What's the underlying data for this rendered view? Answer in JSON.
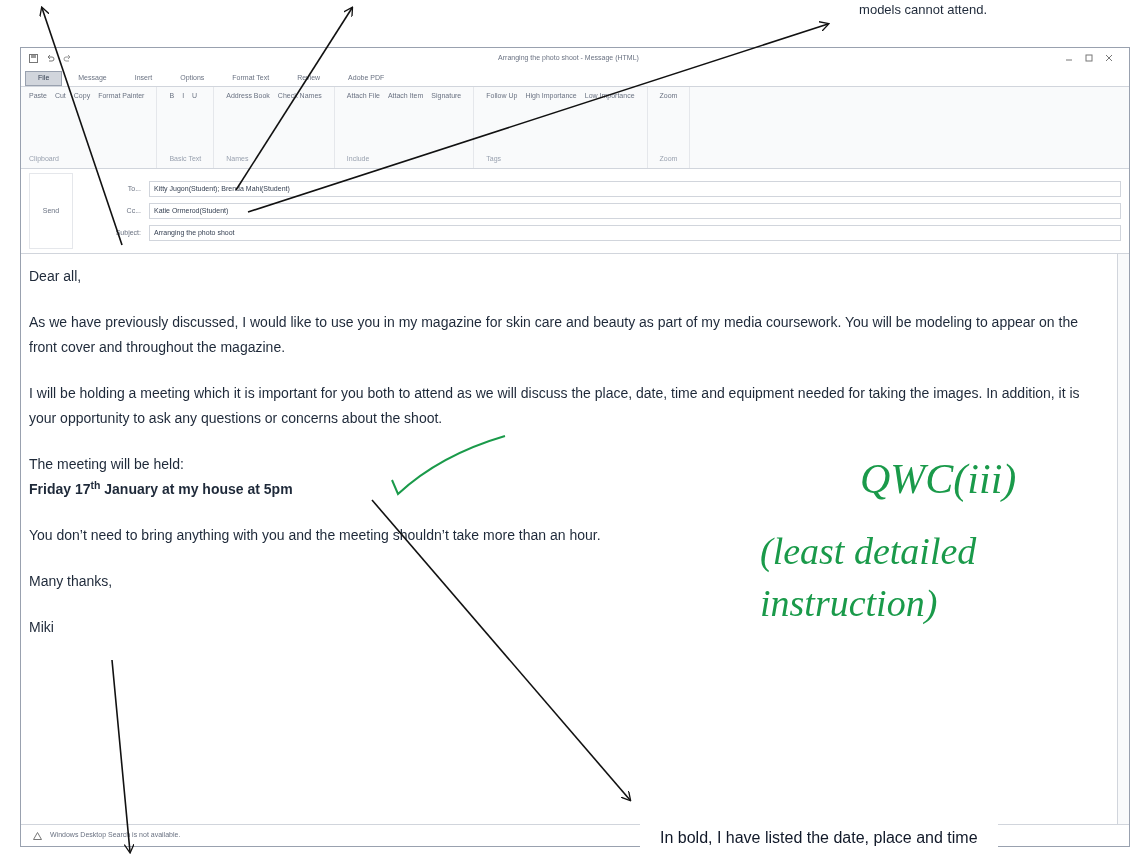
{
  "top_note": "models cannot attend.",
  "window": {
    "title": "Arranging the photo shoot - Message (HTML)"
  },
  "tabs": [
    {
      "label": "File",
      "selected": true
    },
    {
      "label": "Message",
      "selected": false
    },
    {
      "label": "Insert",
      "selected": false
    },
    {
      "label": "Options",
      "selected": false
    },
    {
      "label": "Format Text",
      "selected": false
    },
    {
      "label": "Review",
      "selected": false
    },
    {
      "label": "Adobe PDF",
      "selected": false
    }
  ],
  "ribbon_groups": [
    {
      "label": "Clipboard",
      "buttons": [
        "Paste",
        "Cut",
        "Copy",
        "Format Painter"
      ]
    },
    {
      "label": "Basic Text",
      "buttons": [
        "B",
        "I",
        "U"
      ]
    },
    {
      "label": "Names",
      "buttons": [
        "Address Book",
        "Check Names"
      ]
    },
    {
      "label": "Include",
      "buttons": [
        "Attach File",
        "Attach Item",
        "Signature"
      ]
    },
    {
      "label": "Tags",
      "buttons": [
        "Follow Up",
        "High Importance",
        "Low Importance"
      ]
    },
    {
      "label": "Zoom",
      "buttons": [
        "Zoom"
      ]
    }
  ],
  "header": {
    "send": "Send",
    "fields": [
      {
        "label": "To...",
        "value": "Kitty Jugon(Student); Brenda Mahi(Student)"
      },
      {
        "label": "Cc...",
        "value": "Katie Ormerod(Student)"
      },
      {
        "label": "Subject:",
        "value": "Arranging the photo shoot"
      }
    ]
  },
  "body": [
    {
      "kind": "text",
      "text": "Dear all,"
    },
    {
      "kind": "text",
      "text": "As we have previously discussed, I would like to use you in my magazine for skin care and beauty as part of my media coursework. You will be modeling to appear on the front cover and throughout the magazine."
    },
    {
      "kind": "text",
      "text": "I will be holding a meeting which it is important for you both to attend as we will discuss the place, date, time and equipment needed for taking the images. In addition, it is your opportunity to ask any questions or concerns about the shoot."
    },
    {
      "kind": "text",
      "text": "The meeting will be held:"
    },
    {
      "kind": "bold",
      "text": "Friday 17$^{th}$ January at my house  at 5pm"
    },
    {
      "kind": "text",
      "text": "You don’t need to bring anything with you and the meeting shouldn’t take more than an hour."
    },
    {
      "kind": "text",
      "text": "Many thanks,"
    },
    {
      "kind": "text",
      "text": "Miki"
    }
  ],
  "status_bar": "Windows Desktop Search is not available.",
  "handwritten": [
    "QWC(iii)",
    "(least detailed instruction)"
  ],
  "bottom_note": "In bold, I have listed the date, place and time"
}
